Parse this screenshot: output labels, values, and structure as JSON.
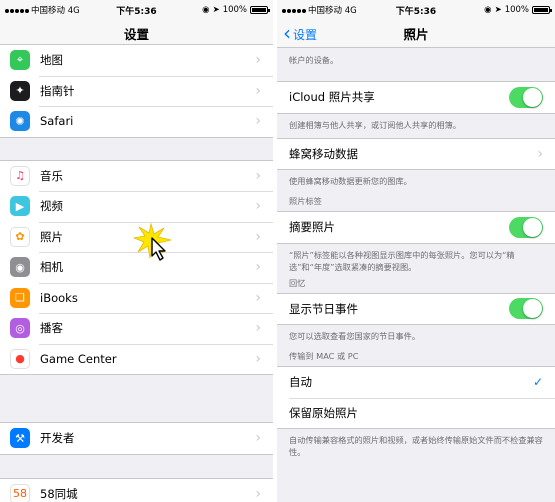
{
  "status": {
    "carrier": "中国移动",
    "network": "4G",
    "time": "下午5:36",
    "battery": "100%"
  },
  "left": {
    "title": "设置",
    "group1": [
      {
        "label": "地图",
        "icon": "maps-icon",
        "color": "#34c759"
      },
      {
        "label": "指南针",
        "icon": "compass-icon",
        "color": "#1c1c1e"
      },
      {
        "label": "Safari",
        "icon": "safari-icon",
        "color": "#1e88e5"
      }
    ],
    "group2": [
      {
        "label": "音乐",
        "icon": "music-icon",
        "color": "#ffffff"
      },
      {
        "label": "视频",
        "icon": "videos-icon",
        "color": "#3ec6e0"
      },
      {
        "label": "照片",
        "icon": "photos-icon",
        "color": "#ffffff"
      },
      {
        "label": "相机",
        "icon": "camera-icon",
        "color": "#8e8e93"
      },
      {
        "label": "iBooks",
        "icon": "ibooks-icon",
        "color": "#ff9500"
      },
      {
        "label": "播客",
        "icon": "podcasts-icon",
        "color": "#b15fe0"
      },
      {
        "label": "Game Center",
        "icon": "game-center-icon",
        "color": "#ffffff"
      }
    ],
    "group3": [
      {
        "label": "开发者",
        "icon": "developer-icon",
        "color": "#007aff"
      }
    ],
    "group4": [
      {
        "label": "58同城",
        "icon": "app-58-icon",
        "color": "#ffffff"
      }
    ]
  },
  "right": {
    "back_label": "设置",
    "title": "照片",
    "top_note": "帐户的设备。",
    "icloud_share": {
      "label": "iCloud 照片共享",
      "on": true,
      "footer": "创建相簿与他人共享，或订阅他人共享的相簿。"
    },
    "cellular": {
      "label": "蜂窝移动数据",
      "footer": "使用蜂窝移动数据更新您的图库。"
    },
    "tags_header": "照片标签",
    "summary": {
      "label": "摘要照片",
      "on": true,
      "footer": "“照片”标签能以各种视图显示图库中的每张照片。您可以为“精选”和“年度”选取紧凑的摘要视图。"
    },
    "memories_header": "回忆",
    "holiday": {
      "label": "显示节日事件",
      "on": true,
      "footer": "您可以选取查看您国家的节日事件。"
    },
    "transfer_header": "传输到 MAC 或 PC",
    "auto": {
      "label": "自动",
      "checked": true
    },
    "keep": {
      "label": "保留原始照片",
      "footer": "自动传输兼容格式的照片和视频，或者始终传输原始文件而不检查兼容性。"
    }
  }
}
